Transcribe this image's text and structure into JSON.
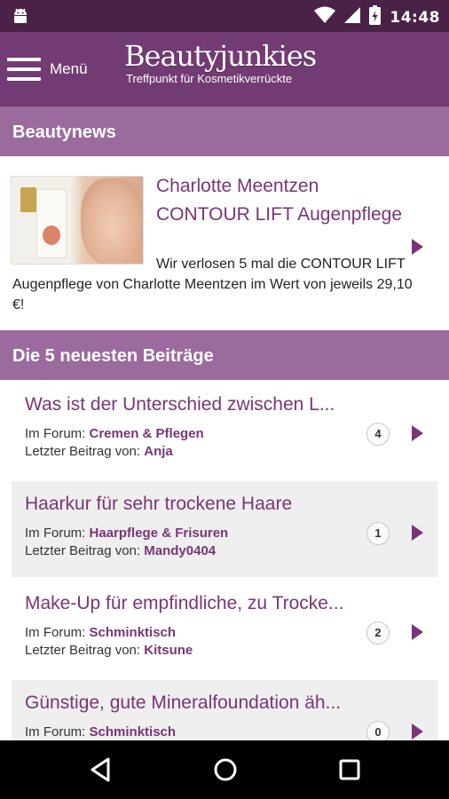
{
  "status_bar": {
    "time": "14:48"
  },
  "header": {
    "menu_label": "Menü",
    "logo_title": "Beautyjunkies",
    "logo_subtitle": "Treffpunkt für Kosmetikverrückte"
  },
  "news_section": {
    "title": "Beautynews",
    "item": {
      "title": "Charlotte Meentzen CONTOUR LIFT Augenpflege",
      "text": "Wir verlosen 5 mal die CONTOUR LIFT Augenpflege von Charlotte Meentzen im Wert von jeweils 29,10 €!"
    }
  },
  "posts_section": {
    "title": "Die 5 neuesten Beiträge",
    "forum_prefix": "Im Forum:",
    "last_post_prefix": "Letzter Beitrag von:",
    "posts": [
      {
        "title": "Was ist der Unterschied zwischen L...",
        "forum": "Cremen & Pflegen",
        "author": "Anja",
        "count": "4"
      },
      {
        "title": "Haarkur für sehr trockene Haare",
        "forum": "Haarpflege & Frisuren",
        "author": "Mandy0404",
        "count": "1"
      },
      {
        "title": "Make-Up für empfindliche, zu Trocke...",
        "forum": "Schminktisch",
        "author": "Kitsune",
        "count": "2"
      },
      {
        "title": "Günstige, gute Mineralfoundation äh...",
        "forum": "Schminktisch",
        "author": "",
        "count": "0"
      }
    ]
  },
  "colors": {
    "header_bg": "#733b73",
    "section_bg": "#9b6b9d",
    "accent": "#7a3577",
    "status_bar_bg": "#4a2248"
  },
  "icons": [
    "android-icon",
    "wifi-icon",
    "signal-icon",
    "battery-icon",
    "menu-icon",
    "play-arrow-icon",
    "back-icon",
    "home-icon",
    "recents-icon"
  ]
}
